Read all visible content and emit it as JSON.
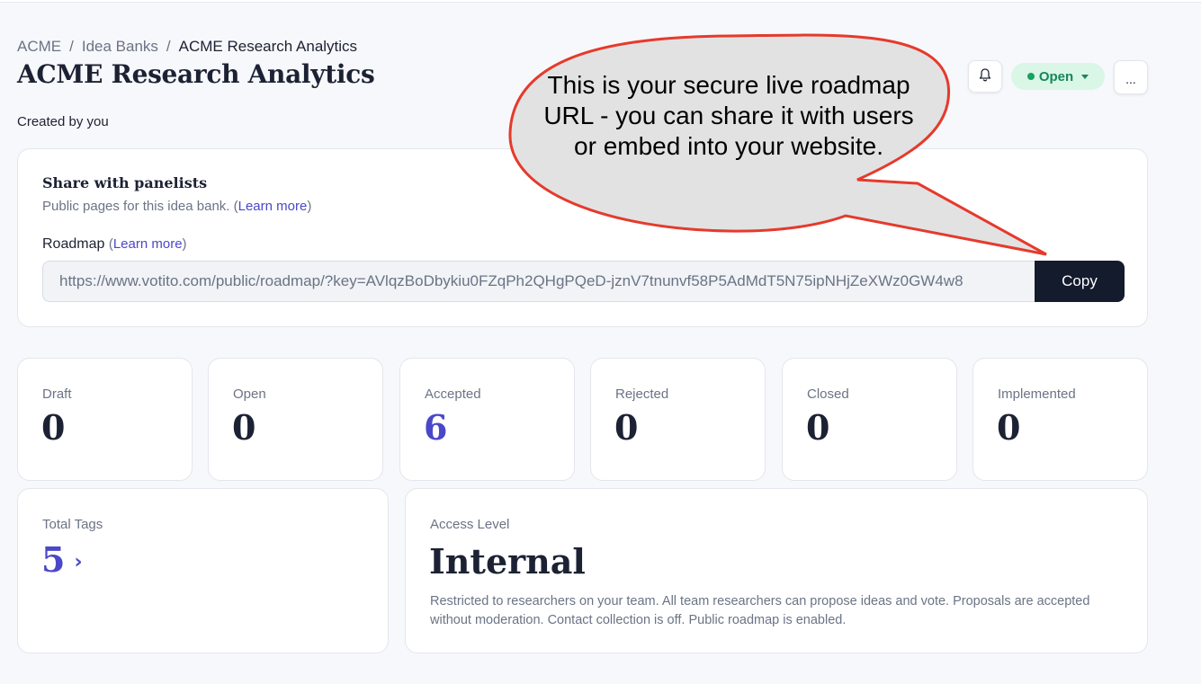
{
  "breadcrumb": {
    "items": [
      "ACME",
      "Idea Banks",
      "ACME Research Analytics"
    ],
    "separator": "/"
  },
  "page": {
    "title": "ACME Research Analytics",
    "created_by": "Created by you"
  },
  "header_actions": {
    "bell_icon": "bell-icon",
    "status_label": "Open",
    "status_color": "#19a15f",
    "more_label": "..."
  },
  "share": {
    "title": "Share with panelists",
    "description_prefix": "Public pages for this idea bank. (",
    "learn_more": "Learn more",
    "paren_close": ")",
    "roadmap_label": "Roadmap",
    "roadmap_learn_more_open": "(",
    "roadmap_learn_more": "Learn more",
    "roadmap_learn_more_close": ")",
    "url": "https://www.votito.com/public/roadmap/?key=AVlqzBoDbykiu0FZqPh2QHgPQeD-jznV7tnunvf58P5AdMdT5N75ipNHjZeXWz0GW4w8",
    "copy_label": "Copy"
  },
  "stats": [
    {
      "label": "Draft",
      "value": "0"
    },
    {
      "label": "Open",
      "value": "0"
    },
    {
      "label": "Accepted",
      "value": "6"
    },
    {
      "label": "Rejected",
      "value": "0"
    },
    {
      "label": "Closed",
      "value": "0"
    },
    {
      "label": "Implemented",
      "value": "0"
    }
  ],
  "tags": {
    "label": "Total Tags",
    "value": "5",
    "chevron": "›"
  },
  "access": {
    "label": "Access Level",
    "value": "Internal",
    "description": "Restricted to researchers on your team. All team researchers can propose ideas and vote. Proposals are accepted without moderation. Contact collection is off. Public roadmap is enabled."
  },
  "callout": {
    "text": "This is your secure live roadmap URL - you can share it with users or embed into your website."
  },
  "colors": {
    "accent": "#4a48c9",
    "primary_button": "#141b2d",
    "status_bg": "#d9f6e6",
    "callout_stroke": "#e53a2c",
    "callout_fill": "#e2e2e2"
  }
}
